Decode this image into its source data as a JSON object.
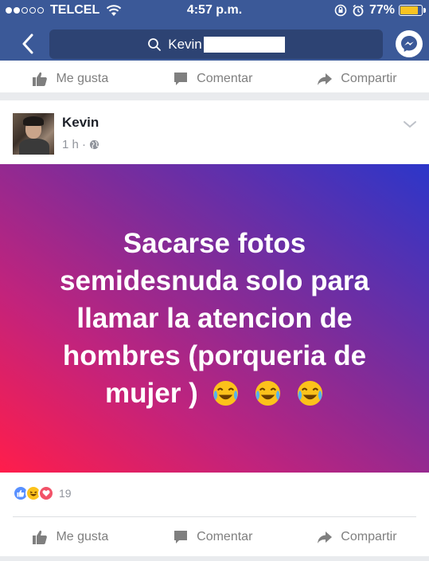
{
  "status_bar": {
    "carrier": "TELCEL",
    "time": "4:57 p.m.",
    "battery_percent": "77%",
    "battery_level": 0.77,
    "signal_bars": 2
  },
  "nav": {
    "search_query": "Kevin",
    "back_icon": "chevron-left-icon",
    "messenger_icon": "messenger-icon"
  },
  "prev_post_actions": {
    "like_label": "Me gusta",
    "comment_label": "Comentar",
    "share_label": "Compartir"
  },
  "post": {
    "author": "Kevin",
    "time": "1 h",
    "privacy_icon": "globe-icon",
    "text_lines": [
      "Sacarse fotos",
      "semidesnuda solo para",
      "llamar la atencion de",
      "hombres (porqueria de",
      "mujer )"
    ],
    "emojis": [
      "😂",
      "😂",
      "😂"
    ],
    "background_colors": [
      "#ff1d4b",
      "#7e2c9a",
      "#2c36c9"
    ],
    "reactions": [
      "like",
      "haha",
      "love"
    ],
    "reaction_count": "19",
    "actions": {
      "like_label": "Me gusta",
      "comment_label": "Comentar",
      "share_label": "Compartir"
    }
  }
}
